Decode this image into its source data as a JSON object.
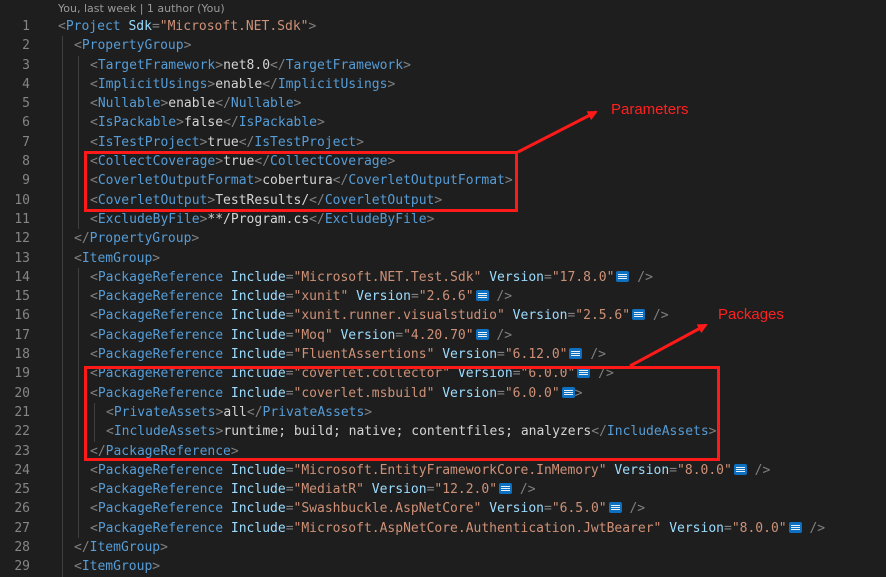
{
  "blame": "You, last week | 1 author (You)",
  "lines": [
    {
      "n": "1",
      "i": 0,
      "t": [
        [
          "p",
          "<"
        ],
        [
          "tag",
          "Project"
        ],
        [
          "text",
          " "
        ],
        [
          "attr",
          "Sdk"
        ],
        [
          "p",
          "="
        ],
        [
          "str",
          "\"Microsoft.NET.Sdk\""
        ],
        [
          "p",
          ">"
        ]
      ]
    },
    {
      "n": "2",
      "i": 1,
      "t": [
        [
          "p",
          "<"
        ],
        [
          "tag",
          "PropertyGroup"
        ],
        [
          "p",
          ">"
        ]
      ]
    },
    {
      "n": "3",
      "i": 2,
      "t": [
        [
          "p",
          "<"
        ],
        [
          "tag",
          "TargetFramework"
        ],
        [
          "p",
          ">"
        ],
        [
          "text",
          "net8.0"
        ],
        [
          "p",
          "</"
        ],
        [
          "tag",
          "TargetFramework"
        ],
        [
          "p",
          ">"
        ]
      ]
    },
    {
      "n": "4",
      "i": 2,
      "t": [
        [
          "p",
          "<"
        ],
        [
          "tag",
          "ImplicitUsings"
        ],
        [
          "p",
          ">"
        ],
        [
          "text",
          "enable"
        ],
        [
          "p",
          "</"
        ],
        [
          "tag",
          "ImplicitUsings"
        ],
        [
          "p",
          ">"
        ]
      ]
    },
    {
      "n": "5",
      "i": 2,
      "t": [
        [
          "p",
          "<"
        ],
        [
          "tag",
          "Nullable"
        ],
        [
          "p",
          ">"
        ],
        [
          "text",
          "enable"
        ],
        [
          "p",
          "</"
        ],
        [
          "tag",
          "Nullable"
        ],
        [
          "p",
          ">"
        ]
      ]
    },
    {
      "n": "6",
      "i": 2,
      "t": [
        [
          "p",
          "<"
        ],
        [
          "tag",
          "IsPackable"
        ],
        [
          "p",
          ">"
        ],
        [
          "text",
          "false"
        ],
        [
          "p",
          "</"
        ],
        [
          "tag",
          "IsPackable"
        ],
        [
          "p",
          ">"
        ]
      ]
    },
    {
      "n": "7",
      "i": 2,
      "t": [
        [
          "p",
          "<"
        ],
        [
          "tag",
          "IsTestProject"
        ],
        [
          "p",
          ">"
        ],
        [
          "text",
          "true"
        ],
        [
          "p",
          "</"
        ],
        [
          "tag",
          "IsTestProject"
        ],
        [
          "p",
          ">"
        ]
      ]
    },
    {
      "n": "8",
      "i": 2,
      "t": [
        [
          "p",
          "<"
        ],
        [
          "tag",
          "CollectCoverage"
        ],
        [
          "p",
          ">"
        ],
        [
          "text",
          "true"
        ],
        [
          "p",
          "</"
        ],
        [
          "tag",
          "CollectCoverage"
        ],
        [
          "p",
          ">"
        ]
      ]
    },
    {
      "n": "9",
      "i": 2,
      "t": [
        [
          "p",
          "<"
        ],
        [
          "tag",
          "CoverletOutputFormat"
        ],
        [
          "p",
          ">"
        ],
        [
          "text",
          "cobertura"
        ],
        [
          "p",
          "</"
        ],
        [
          "tag",
          "CoverletOutputFormat"
        ],
        [
          "p",
          ">"
        ]
      ]
    },
    {
      "n": "10",
      "i": 2,
      "t": [
        [
          "p",
          "<"
        ],
        [
          "tag",
          "CoverletOutput"
        ],
        [
          "p",
          ">"
        ],
        [
          "text",
          "TestResults/"
        ],
        [
          "p",
          "</"
        ],
        [
          "tag",
          "CoverletOutput"
        ],
        [
          "p",
          ">"
        ]
      ]
    },
    {
      "n": "11",
      "i": 2,
      "t": [
        [
          "p",
          "<"
        ],
        [
          "tag",
          "ExcludeByFile"
        ],
        [
          "p",
          ">"
        ],
        [
          "text",
          "**/Program.cs"
        ],
        [
          "p",
          "</"
        ],
        [
          "tag",
          "ExcludeByFile"
        ],
        [
          "p",
          ">"
        ]
      ]
    },
    {
      "n": "12",
      "i": 1,
      "t": [
        [
          "p",
          "</"
        ],
        [
          "tag",
          "PropertyGroup"
        ],
        [
          "p",
          ">"
        ]
      ]
    },
    {
      "n": "13",
      "i": 1,
      "t": [
        [
          "p",
          "<"
        ],
        [
          "tag",
          "ItemGroup"
        ],
        [
          "p",
          ">"
        ]
      ]
    },
    {
      "n": "14",
      "i": 2,
      "t": [
        [
          "p",
          "<"
        ],
        [
          "tag",
          "PackageReference"
        ],
        [
          "text",
          " "
        ],
        [
          "attr",
          "Include"
        ],
        [
          "p",
          "="
        ],
        [
          "str",
          "\"Microsoft.NET.Test.Sdk\""
        ],
        [
          "text",
          " "
        ],
        [
          "attr",
          "Version"
        ],
        [
          "p",
          "="
        ],
        [
          "str",
          "\"17.8.0\""
        ],
        [
          "badge",
          ""
        ],
        [
          "text",
          " "
        ],
        [
          "p",
          "/>"
        ]
      ]
    },
    {
      "n": "15",
      "i": 2,
      "t": [
        [
          "p",
          "<"
        ],
        [
          "tag",
          "PackageReference"
        ],
        [
          "text",
          " "
        ],
        [
          "attr",
          "Include"
        ],
        [
          "p",
          "="
        ],
        [
          "str",
          "\"xunit\""
        ],
        [
          "text",
          " "
        ],
        [
          "attr",
          "Version"
        ],
        [
          "p",
          "="
        ],
        [
          "str",
          "\"2.6.6\""
        ],
        [
          "badge",
          ""
        ],
        [
          "text",
          " "
        ],
        [
          "p",
          "/>"
        ]
      ]
    },
    {
      "n": "16",
      "i": 2,
      "t": [
        [
          "p",
          "<"
        ],
        [
          "tag",
          "PackageReference"
        ],
        [
          "text",
          " "
        ],
        [
          "attr",
          "Include"
        ],
        [
          "p",
          "="
        ],
        [
          "str",
          "\"xunit.runner.visualstudio\""
        ],
        [
          "text",
          " "
        ],
        [
          "attr",
          "Version"
        ],
        [
          "p",
          "="
        ],
        [
          "str",
          "\"2.5.6\""
        ],
        [
          "badge",
          ""
        ],
        [
          "text",
          " "
        ],
        [
          "p",
          "/>"
        ]
      ]
    },
    {
      "n": "17",
      "i": 2,
      "t": [
        [
          "p",
          "<"
        ],
        [
          "tag",
          "PackageReference"
        ],
        [
          "text",
          " "
        ],
        [
          "attr",
          "Include"
        ],
        [
          "p",
          "="
        ],
        [
          "str",
          "\"Moq\""
        ],
        [
          "text",
          " "
        ],
        [
          "attr",
          "Version"
        ],
        [
          "p",
          "="
        ],
        [
          "str",
          "\"4.20.70\""
        ],
        [
          "badge",
          ""
        ],
        [
          "text",
          " "
        ],
        [
          "p",
          "/>"
        ]
      ]
    },
    {
      "n": "18",
      "i": 2,
      "t": [
        [
          "p",
          "<"
        ],
        [
          "tag",
          "PackageReference"
        ],
        [
          "text",
          " "
        ],
        [
          "attr",
          "Include"
        ],
        [
          "p",
          "="
        ],
        [
          "str",
          "\"FluentAssertions\""
        ],
        [
          "text",
          " "
        ],
        [
          "attr",
          "Version"
        ],
        [
          "p",
          "="
        ],
        [
          "str",
          "\"6.12.0\""
        ],
        [
          "badge",
          ""
        ],
        [
          "text",
          " "
        ],
        [
          "p",
          "/>"
        ]
      ]
    },
    {
      "n": "19",
      "i": 2,
      "t": [
        [
          "p",
          "<"
        ],
        [
          "tag",
          "PackageReference"
        ],
        [
          "text",
          " "
        ],
        [
          "attr",
          "Include"
        ],
        [
          "p",
          "="
        ],
        [
          "str",
          "\"coverlet.collector\""
        ],
        [
          "text",
          " "
        ],
        [
          "attr",
          "Version"
        ],
        [
          "p",
          "="
        ],
        [
          "str",
          "\"6.0.0\""
        ],
        [
          "badge",
          ""
        ],
        [
          "text",
          " "
        ],
        [
          "p",
          "/>"
        ]
      ]
    },
    {
      "n": "20",
      "i": 2,
      "t": [
        [
          "p",
          "<"
        ],
        [
          "tag",
          "PackageReference"
        ],
        [
          "text",
          " "
        ],
        [
          "attr",
          "Include"
        ],
        [
          "p",
          "="
        ],
        [
          "str",
          "\"coverlet.msbuild\""
        ],
        [
          "text",
          " "
        ],
        [
          "attr",
          "Version"
        ],
        [
          "p",
          "="
        ],
        [
          "str",
          "\"6.0.0\""
        ],
        [
          "badge",
          ""
        ],
        [
          "p",
          ">"
        ]
      ]
    },
    {
      "n": "21",
      "i": 3,
      "t": [
        [
          "p",
          "<"
        ],
        [
          "tag",
          "PrivateAssets"
        ],
        [
          "p",
          ">"
        ],
        [
          "text",
          "all"
        ],
        [
          "p",
          "</"
        ],
        [
          "tag",
          "PrivateAssets"
        ],
        [
          "p",
          ">"
        ]
      ]
    },
    {
      "n": "22",
      "i": 3,
      "t": [
        [
          "p",
          "<"
        ],
        [
          "tag",
          "IncludeAssets"
        ],
        [
          "p",
          ">"
        ],
        [
          "text",
          "runtime; build; native; contentfiles; analyzers"
        ],
        [
          "p",
          "</"
        ],
        [
          "tag",
          "IncludeAssets"
        ],
        [
          "p",
          ">"
        ]
      ]
    },
    {
      "n": "23",
      "i": 2,
      "t": [
        [
          "p",
          "</"
        ],
        [
          "tag",
          "PackageReference"
        ],
        [
          "p",
          ">"
        ]
      ]
    },
    {
      "n": "24",
      "i": 2,
      "t": [
        [
          "p",
          "<"
        ],
        [
          "tag",
          "PackageReference"
        ],
        [
          "text",
          " "
        ],
        [
          "attr",
          "Include"
        ],
        [
          "p",
          "="
        ],
        [
          "str",
          "\"Microsoft.EntityFrameworkCore.InMemory\""
        ],
        [
          "text",
          " "
        ],
        [
          "attr",
          "Version"
        ],
        [
          "p",
          "="
        ],
        [
          "str",
          "\"8.0.0\""
        ],
        [
          "badge",
          ""
        ],
        [
          "text",
          " "
        ],
        [
          "p",
          "/>"
        ]
      ]
    },
    {
      "n": "25",
      "i": 2,
      "t": [
        [
          "p",
          "<"
        ],
        [
          "tag",
          "PackageReference"
        ],
        [
          "text",
          " "
        ],
        [
          "attr",
          "Include"
        ],
        [
          "p",
          "="
        ],
        [
          "str",
          "\"MediatR\""
        ],
        [
          "text",
          " "
        ],
        [
          "attr",
          "Version"
        ],
        [
          "p",
          "="
        ],
        [
          "str",
          "\"12.2.0\""
        ],
        [
          "badge",
          ""
        ],
        [
          "text",
          " "
        ],
        [
          "p",
          "/>"
        ]
      ]
    },
    {
      "n": "26",
      "i": 2,
      "t": [
        [
          "p",
          "<"
        ],
        [
          "tag",
          "PackageReference"
        ],
        [
          "text",
          " "
        ],
        [
          "attr",
          "Include"
        ],
        [
          "p",
          "="
        ],
        [
          "str",
          "\"Swashbuckle.AspNetCore\""
        ],
        [
          "text",
          " "
        ],
        [
          "attr",
          "Version"
        ],
        [
          "p",
          "="
        ],
        [
          "str",
          "\"6.5.0\""
        ],
        [
          "badge",
          ""
        ],
        [
          "text",
          " "
        ],
        [
          "p",
          "/>"
        ]
      ]
    },
    {
      "n": "27",
      "i": 2,
      "t": [
        [
          "p",
          "<"
        ],
        [
          "tag",
          "PackageReference"
        ],
        [
          "text",
          " "
        ],
        [
          "attr",
          "Include"
        ],
        [
          "p",
          "="
        ],
        [
          "str",
          "\"Microsoft.AspNetCore.Authentication.JwtBearer\""
        ],
        [
          "text",
          " "
        ],
        [
          "attr",
          "Version"
        ],
        [
          "p",
          "="
        ],
        [
          "str",
          "\"8.0.0\""
        ],
        [
          "badge",
          ""
        ],
        [
          "text",
          " "
        ],
        [
          "p",
          "/>"
        ]
      ]
    },
    {
      "n": "28",
      "i": 1,
      "t": [
        [
          "p",
          "</"
        ],
        [
          "tag",
          "ItemGroup"
        ],
        [
          "p",
          ">"
        ]
      ]
    },
    {
      "n": "29",
      "i": 1,
      "t": [
        [
          "p",
          "<"
        ],
        [
          "tag",
          "ItemGroup"
        ],
        [
          "p",
          ">"
        ]
      ]
    }
  ],
  "annotations": {
    "parameters_label": "Parameters",
    "packages_label": "Packages",
    "box_color": "#ff1a1a"
  },
  "colors": {
    "background": "#1e1e1e",
    "line_number": "#858585",
    "punctuation": "#808080",
    "tag": "#569cd6",
    "attribute": "#9cdcfe",
    "string": "#ce9178",
    "text": "#d4d4d4",
    "new_badge": "#0e70c0"
  }
}
